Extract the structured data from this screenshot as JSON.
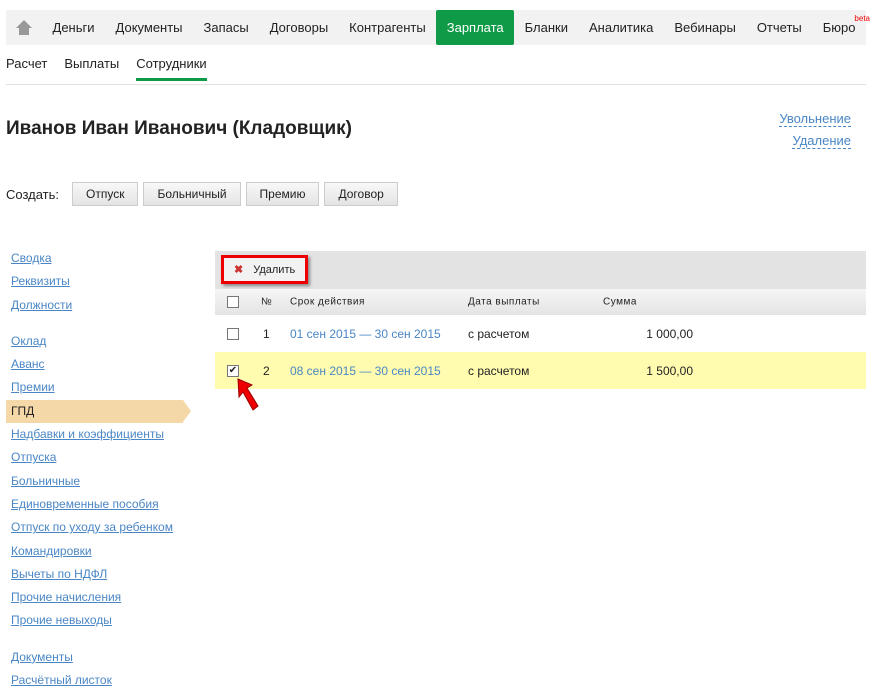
{
  "nav": {
    "items": [
      "Деньги",
      "Документы",
      "Запасы",
      "Договоры",
      "Контрагенты",
      "Зарплата",
      "Бланки",
      "Аналитика",
      "Вебинары",
      "Отчеты",
      "Бюро"
    ],
    "beta": "beta",
    "active": "Зарплата"
  },
  "subnav": [
    "Расчет",
    "Выплаты",
    "Сотрудники"
  ],
  "title": "Иванов Иван Иванович (Кладовщик)",
  "links": {
    "dismiss": "Увольнение",
    "delete": "Удаление"
  },
  "create": {
    "label": "Создать:",
    "buttons": [
      "Отпуск",
      "Больничный",
      "Премию",
      "Договор"
    ]
  },
  "sidebar": {
    "g1": [
      "Сводка",
      "Реквизиты",
      "Должности"
    ],
    "g2": [
      "Оклад",
      "Аванс",
      "Премии",
      "ГПД",
      "Надбавки и коэффициенты",
      "Отпуска",
      "Больничные",
      "Единовременные пособия",
      "Отпуск по уходу за ребенком",
      "Командировки",
      "Вычеты по НДФЛ",
      "Прочие начисления",
      "Прочие невыходы"
    ],
    "g3": [
      "Документы",
      "Расчётный листок"
    ]
  },
  "grid": {
    "delete": "Удалить",
    "headers": {
      "num": "№",
      "period": "Срок действия",
      "pay": "Дата выплаты",
      "sum": "Сумма"
    },
    "rows": [
      {
        "num": "1",
        "period": "01 сен 2015 — 30 сен 2015",
        "pay": "с расчетом",
        "sum": "1 000,00",
        "checked": false
      },
      {
        "num": "2",
        "period": "08 сен 2015 — 30 сен 2015",
        "pay": "с расчетом",
        "sum": "1 500,00",
        "checked": true
      }
    ]
  }
}
